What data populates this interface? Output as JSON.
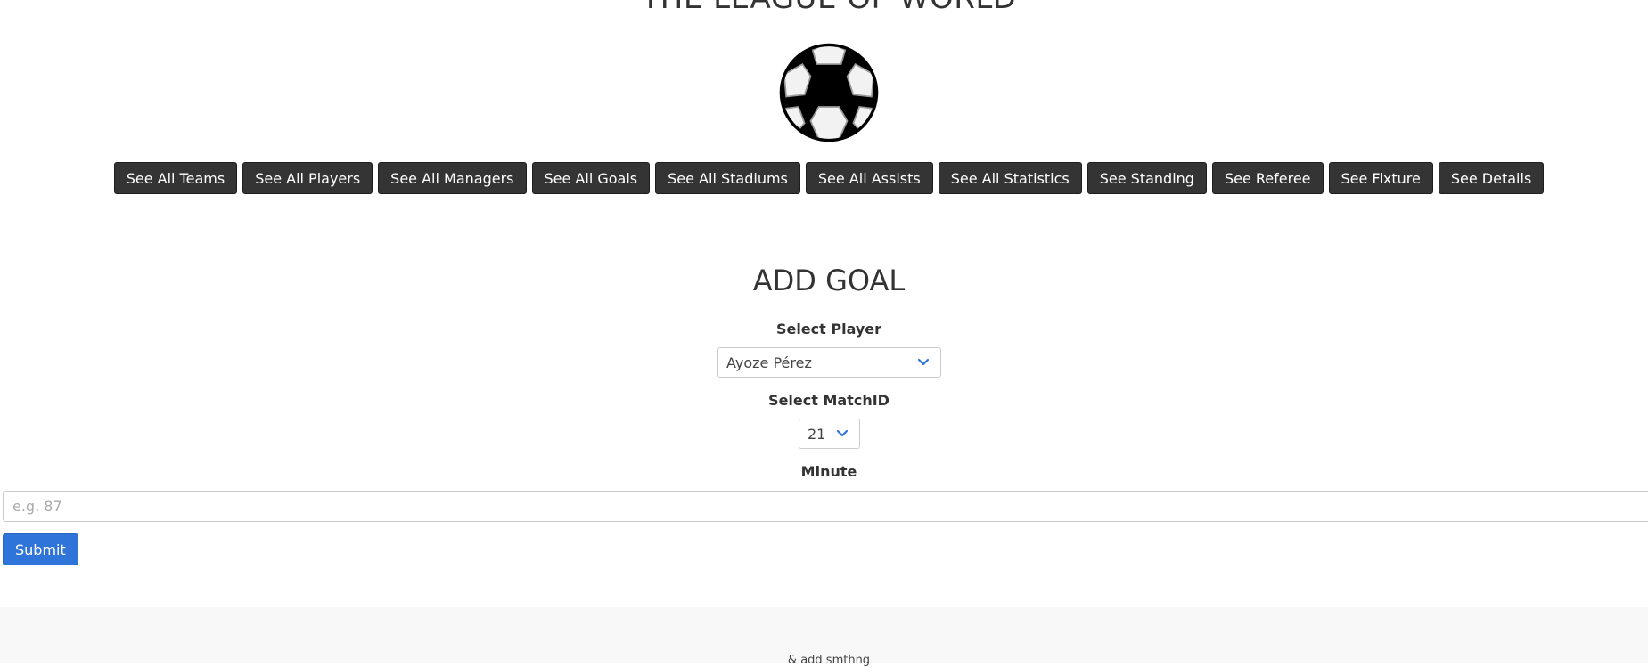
{
  "header": {
    "title": "THE LEAGUE OF WORLD",
    "logo_icon": "soccer-ball-icon"
  },
  "nav": {
    "items": [
      "See All Teams",
      "See All Players",
      "See All Managers",
      "See All Goals",
      "See All Stadiums",
      "See All Assists",
      "See All Statistics",
      "See Standing",
      "See Referee",
      "See Fixture",
      "See Details"
    ]
  },
  "form": {
    "title": "ADD GOAL",
    "player_label": "Select Player",
    "player_value": "Ayoze Pérez",
    "match_label": "Select MatchID",
    "match_value": "21",
    "minute_label": "Minute",
    "minute_placeholder": "e.g. 87",
    "submit_label": "Submit"
  },
  "footer": {
    "text": "& add smthng"
  },
  "colors": {
    "nav_button_bg": "#343434",
    "submit_bg": "#2f74d9",
    "chevron": "#2f74d9",
    "footer_bg": "#f8f8f8"
  }
}
